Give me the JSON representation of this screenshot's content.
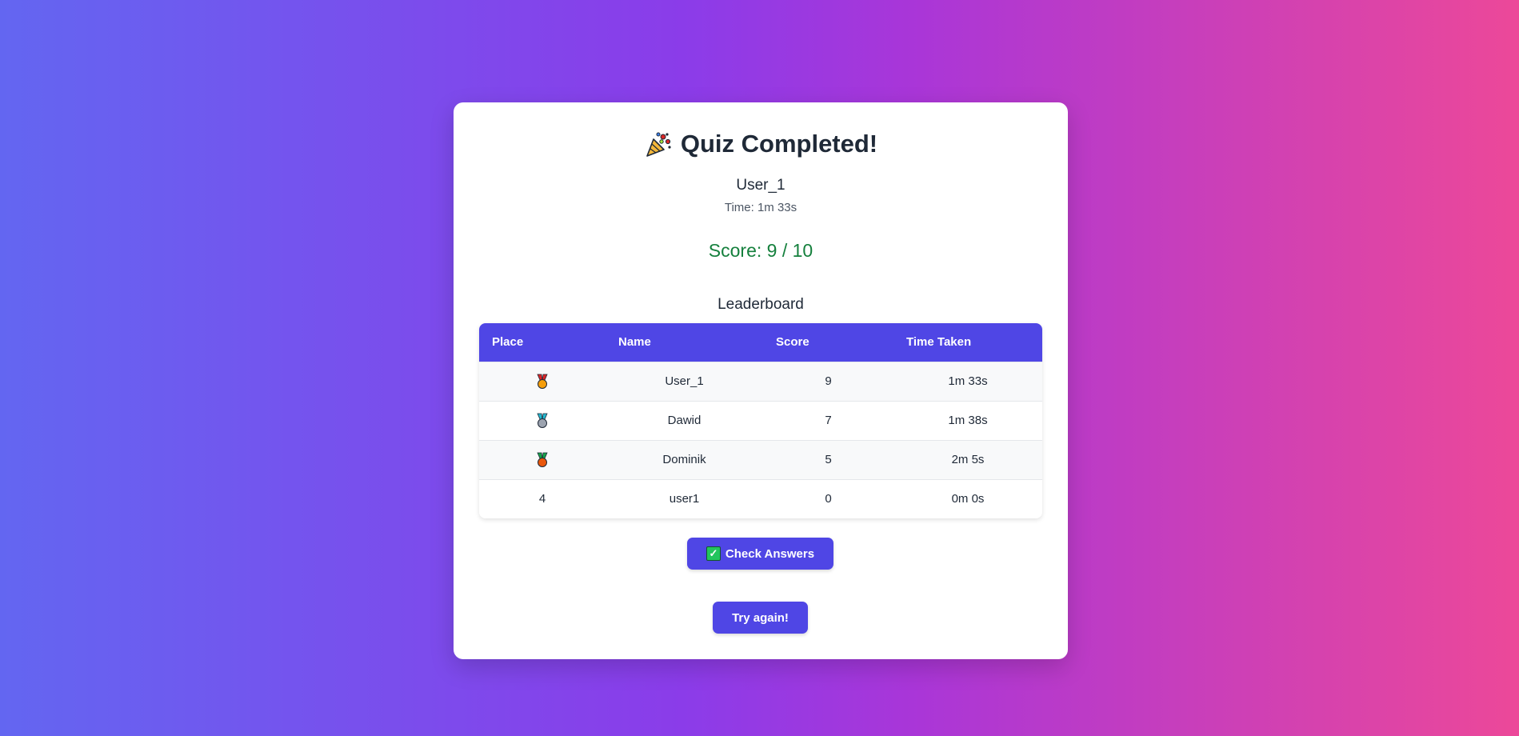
{
  "result": {
    "title": "Quiz Completed!",
    "title_icon": "party-popper-icon",
    "username": "User_1",
    "time_text": "Time: 1m 33s",
    "score_text": "Score: 9 / 10",
    "score_color": "#15803d"
  },
  "leaderboard": {
    "title": "Leaderboard",
    "headers": [
      "Place",
      "Name",
      "Score",
      "Time Taken"
    ],
    "rows": [
      {
        "place": "",
        "place_icon": "gold-medal-icon",
        "name": "User_1",
        "score": "9",
        "time": "1m 33s"
      },
      {
        "place": "",
        "place_icon": "silver-medal-icon",
        "name": "Dawid",
        "score": "7",
        "time": "1m 38s"
      },
      {
        "place": "",
        "place_icon": "bronze-medal-icon",
        "name": "Dominik",
        "score": "5",
        "time": "2m 5s"
      },
      {
        "place": "4",
        "place_icon": "",
        "name": "user1",
        "score": "0",
        "time": "0m 0s"
      }
    ],
    "header_color": "#4f46e5"
  },
  "actions": {
    "check_answers_label": "Check Answers",
    "check_answers_icon": "check-mark-icon",
    "try_again_label": "Try again!"
  },
  "colors": {
    "accent": "#4f46e5",
    "gradient_start": "#6366f1",
    "gradient_end": "#ec4899"
  }
}
